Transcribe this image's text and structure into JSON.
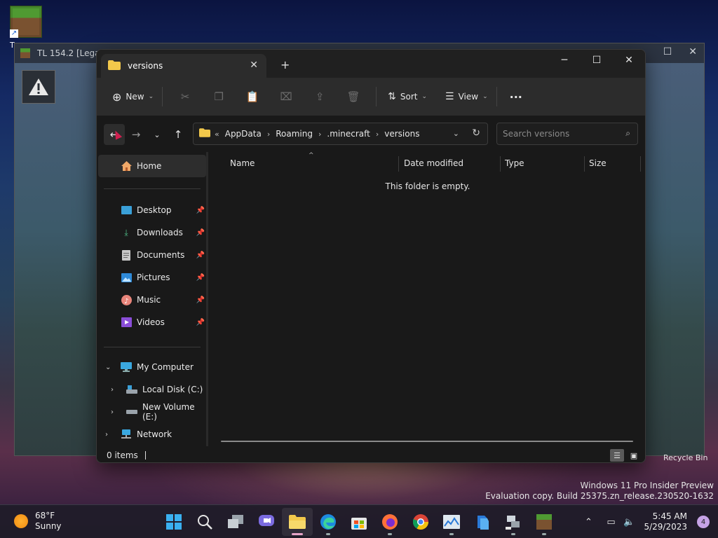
{
  "desktop": {
    "icon_label": "T",
    "bg_window_title": "TL 154.2 [Legacy",
    "recycle_bin": "Recycle Bin",
    "watermark_line1": "Windows 11 Pro Insider Preview",
    "watermark_line2": "Evaluation copy. Build 25375.zn_release.230520-1632"
  },
  "explorer": {
    "tab_title": "versions",
    "toolbar": {
      "new_label": "New",
      "sort_label": "Sort",
      "view_label": "View",
      "more_label": "···"
    },
    "breadcrumb": {
      "overflow": "«",
      "items": [
        "AppData",
        "Roaming",
        ".minecraft",
        "versions"
      ]
    },
    "search_placeholder": "Search versions",
    "sidebar": {
      "home": "Home",
      "quick_access": [
        "Desktop",
        "Downloads",
        "Documents",
        "Pictures",
        "Music",
        "Videos"
      ],
      "my_computer": "My Computer",
      "drives": [
        "Local Disk (C:)",
        "New Volume (E:)"
      ],
      "network": "Network"
    },
    "columns": [
      "Name",
      "Date modified",
      "Type",
      "Size"
    ],
    "empty_message": "This folder is empty.",
    "status": "0 items"
  },
  "taskbar": {
    "temperature": "68°F",
    "condition": "Sunny",
    "time": "5:45 AM",
    "date": "5/29/2023",
    "notifications": "4",
    "apps": [
      "start",
      "search",
      "task-view",
      "teams-chat",
      "file-explorer",
      "edge",
      "store",
      "firefox",
      "chrome",
      "task-manager",
      "hyper-v",
      "network-tool",
      "minecraft"
    ]
  },
  "colors": {
    "window_bg": "#191919",
    "toolbar_bg": "#2c2c2c",
    "folder_yellow": "#f2c84b",
    "accent_pink": "#e7a4c8"
  }
}
